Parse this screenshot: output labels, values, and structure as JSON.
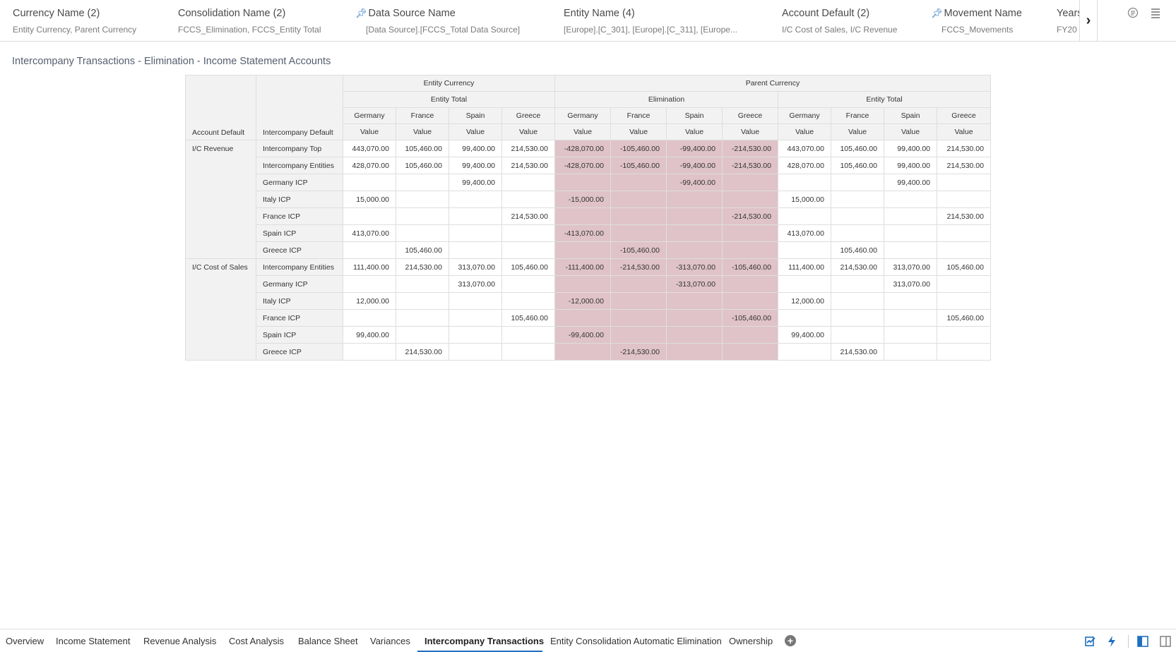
{
  "filters": [
    {
      "title": "Currency Name (2)",
      "value": "Entity Currency, Parent Currency",
      "pinned": false
    },
    {
      "title": "Consolidation Name (2)",
      "value": "FCCS_Elimination, FCCS_Entity Total",
      "pinned": false
    },
    {
      "title": "Data Source Name",
      "value": "[Data Source].[FCCS_Total Data Source]",
      "pinned": true
    },
    {
      "title": "Entity Name (4)",
      "value": "[Europe].[C_301], [Europe].[C_311], [Europe...",
      "pinned": false
    },
    {
      "title": "Account Default (2)",
      "value": "I/C Cost of Sales, I/C Revenue",
      "pinned": false
    },
    {
      "title": "Movement Name",
      "value": "FCCS_Movements",
      "pinned": true
    },
    {
      "title": "Years",
      "value": "FY20",
      "pinned": false
    }
  ],
  "filter_bar": {
    "next_icon": "chevron-right-icon",
    "right_icons": [
      "comment-icon",
      "menu-icon"
    ]
  },
  "report_title": "Intercompany Transactions - Elimination - Income Statement Accounts",
  "grid": {
    "corner_labels": [
      "Account Default",
      "Intercompany Default"
    ],
    "currency_headers": [
      "Entity Currency",
      "Parent Currency"
    ],
    "consolidation_headers": [
      "Entity Total",
      "Elimination",
      "Entity Total"
    ],
    "entity_headers": [
      "Germany",
      "France",
      "Spain",
      "Greece",
      "Germany",
      "France",
      "Spain",
      "Greece",
      "Germany",
      "France",
      "Spain",
      "Greece"
    ],
    "value_label": "Value",
    "rows": [
      {
        "account": "I/C Revenue",
        "ic": "Intercompany Top",
        "cells": [
          "443,070.00",
          "105,460.00",
          "99,400.00",
          "214,530.00",
          "-428,070.00",
          "-105,460.00",
          "-99,400.00",
          "-214,530.00",
          "443,070.00",
          "105,460.00",
          "99,400.00",
          "214,530.00"
        ]
      },
      {
        "account": "",
        "ic": "Intercompany Entities",
        "cells": [
          "428,070.00",
          "105,460.00",
          "99,400.00",
          "214,530.00",
          "-428,070.00",
          "-105,460.00",
          "-99,400.00",
          "-214,530.00",
          "428,070.00",
          "105,460.00",
          "99,400.00",
          "214,530.00"
        ]
      },
      {
        "account": "",
        "ic": "Germany ICP",
        "cells": [
          "",
          "",
          "99,400.00",
          "",
          "",
          "",
          "-99,400.00",
          "",
          "",
          "",
          "99,400.00",
          ""
        ]
      },
      {
        "account": "",
        "ic": "Italy ICP",
        "cells": [
          "15,000.00",
          "",
          "",
          "",
          "-15,000.00",
          "",
          "",
          "",
          "15,000.00",
          "",
          "",
          ""
        ]
      },
      {
        "account": "",
        "ic": "France ICP",
        "cells": [
          "",
          "",
          "",
          "214,530.00",
          "",
          "",
          "",
          "-214,530.00",
          "",
          "",
          "",
          "214,530.00"
        ]
      },
      {
        "account": "",
        "ic": "Spain ICP",
        "cells": [
          "413,070.00",
          "",
          "",
          "",
          "-413,070.00",
          "",
          "",
          "",
          "413,070.00",
          "",
          "",
          ""
        ]
      },
      {
        "account": "",
        "ic": "Greece ICP",
        "cells": [
          "",
          "105,460.00",
          "",
          "",
          "",
          "-105,460.00",
          "",
          "",
          "",
          "105,460.00",
          "",
          ""
        ]
      },
      {
        "account": "I/C Cost of Sales",
        "ic": "Intercompany Entities",
        "cells": [
          "111,400.00",
          "214,530.00",
          "313,070.00",
          "105,460.00",
          "-111,400.00",
          "-214,530.00",
          "-313,070.00",
          "-105,460.00",
          "111,400.00",
          "214,530.00",
          "313,070.00",
          "105,460.00"
        ]
      },
      {
        "account": "",
        "ic": "Germany ICP",
        "cells": [
          "",
          "",
          "313,070.00",
          "",
          "",
          "",
          "-313,070.00",
          "",
          "",
          "",
          "313,070.00",
          ""
        ]
      },
      {
        "account": "",
        "ic": "Italy ICP",
        "cells": [
          "12,000.00",
          "",
          "",
          "",
          "-12,000.00",
          "",
          "",
          "",
          "12,000.00",
          "",
          "",
          ""
        ]
      },
      {
        "account": "",
        "ic": "France ICP",
        "cells": [
          "",
          "",
          "",
          "105,460.00",
          "",
          "",
          "",
          "-105,460.00",
          "",
          "",
          "",
          "105,460.00"
        ]
      },
      {
        "account": "",
        "ic": "Spain ICP",
        "cells": [
          "99,400.00",
          "",
          "",
          "",
          "-99,400.00",
          "",
          "",
          "",
          "99,400.00",
          "",
          "",
          ""
        ]
      },
      {
        "account": "",
        "ic": "Greece ICP",
        "cells": [
          "",
          "214,530.00",
          "",
          "",
          "",
          "-214,530.00",
          "",
          "",
          "",
          "214,530.00",
          "",
          ""
        ]
      }
    ]
  },
  "tabs": [
    {
      "label": "Overview",
      "active": false
    },
    {
      "label": "Income Statement",
      "active": false
    },
    {
      "label": "Revenue Analysis",
      "active": false
    },
    {
      "label": "Cost Analysis",
      "active": false
    },
    {
      "label": "Balance Sheet",
      "active": false
    },
    {
      "label": "Variances",
      "active": false
    },
    {
      "label": "Intercompany Transactions",
      "active": true
    },
    {
      "label": "Entity Consolidation Automatic Elimination",
      "active": false
    },
    {
      "label": "Ownership",
      "active": false
    }
  ],
  "bottom_icons": [
    "auto-insights-icon",
    "quick-analysis-icon",
    "left-panel-icon",
    "right-panel-icon"
  ],
  "colors": {
    "elimination_fill": "#dfc3c8",
    "header_fill": "#f2f2f2",
    "accent": "#1f6fbf"
  }
}
